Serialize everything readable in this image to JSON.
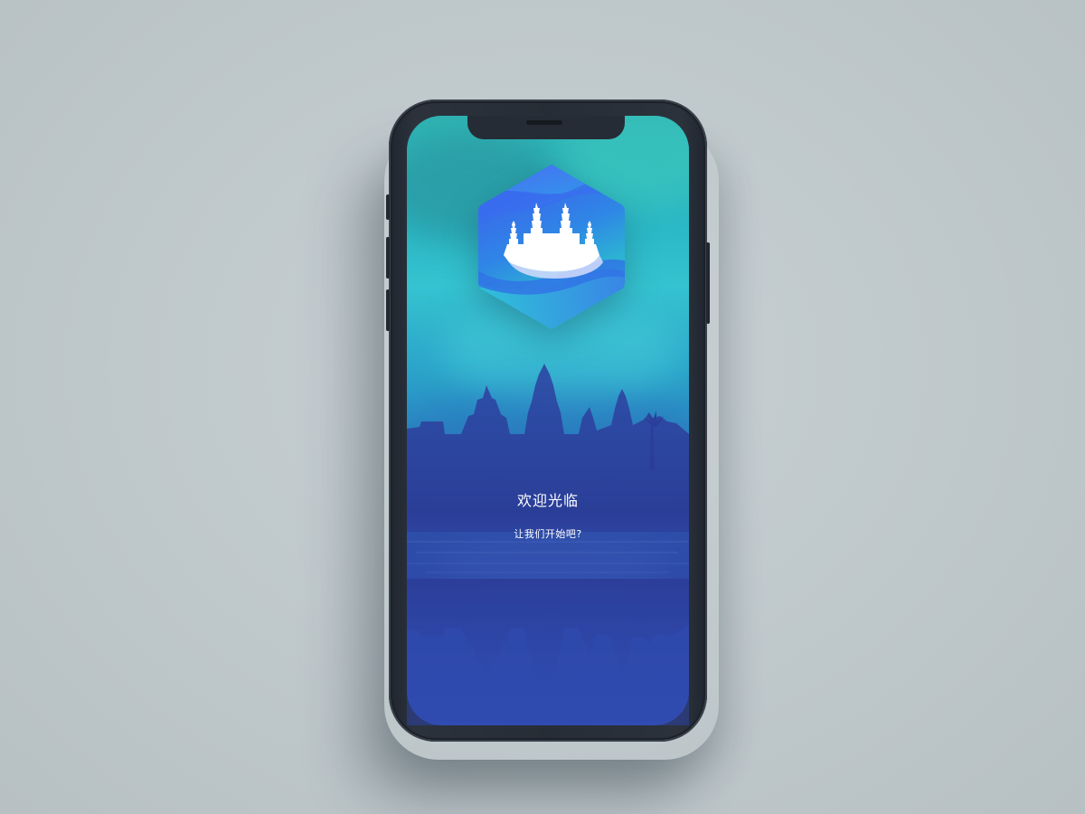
{
  "welcome": {
    "title": "欢迎光临",
    "subtitle": "让我们开始吧?"
  },
  "logo": {
    "icon": "angkor-wat-temple-icon",
    "colors": {
      "hex_top": "#3b5cf0",
      "hex_bottom": "#2ad0c8",
      "temple": "#ffffff"
    }
  },
  "background": {
    "scene": "angkor-wat-silhouette-reflection",
    "colors": {
      "sky_top": "#2fb3b2",
      "sky_mid": "#35c3d0",
      "water": "#2f4fb0",
      "silhouette": "#2d3f9a"
    }
  },
  "device": {
    "frame_color": "#272d36"
  }
}
